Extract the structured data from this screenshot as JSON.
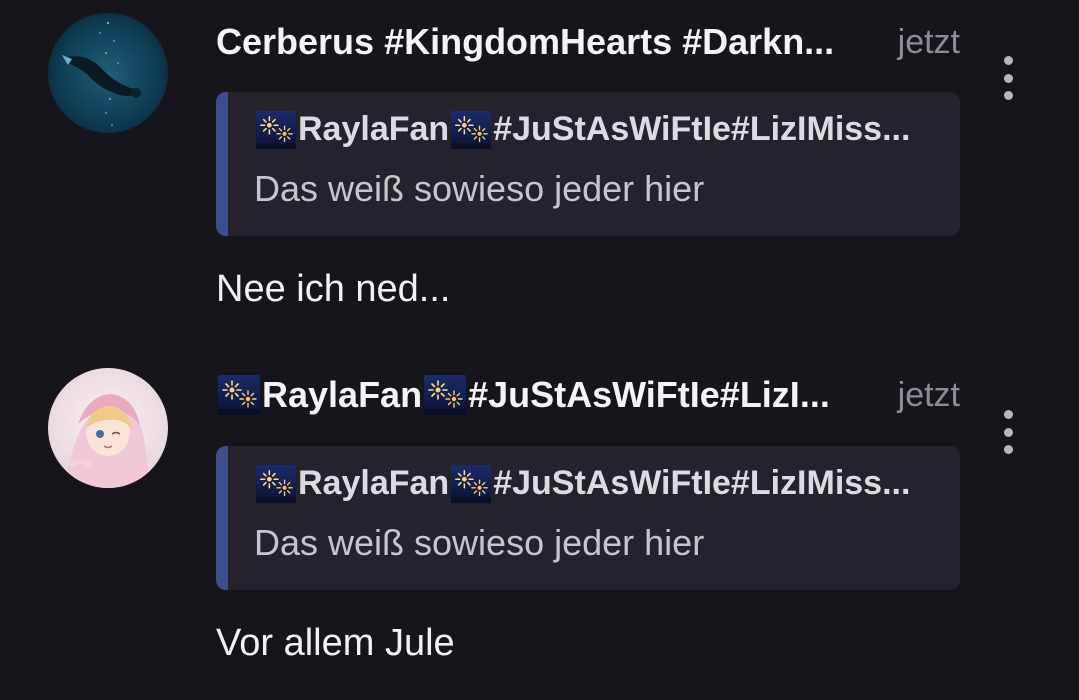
{
  "messages": [
    {
      "author": "Cerberus #KingdomHearts #Darkn...",
      "timestamp": "jetzt",
      "avatar_icon": "space-diver-avatar",
      "quote": {
        "author_parts": [
          "RaylaFan",
          "#JuStAsWiFtIe#LizIMiss..."
        ],
        "author_emoji": "fireworks-emoji",
        "text": "Das weiß sowieso jeder hier"
      },
      "body": "Nee ich ned..."
    },
    {
      "author_parts": [
        "RaylaFan",
        "#JuStAsWiFtIe#LizI..."
      ],
      "author_emoji": "fireworks-emoji",
      "timestamp": "jetzt",
      "avatar_icon": "anime-girl-avatar",
      "quote": {
        "author_parts": [
          "RaylaFan",
          "#JuStAsWiFtIe#LizIMiss..."
        ],
        "author_emoji": "fireworks-emoji",
        "text": "Das weiß sowieso jeder hier"
      },
      "body": "Vor allem Jule"
    }
  ],
  "colors": {
    "background": "#16151c",
    "quote_background": "#24232c",
    "quote_accent": "#3d4e8c",
    "timestamp": "#8e8c96"
  },
  "icons": {
    "more": "more-vertical-icon",
    "emoji": "fireworks-emoji"
  }
}
